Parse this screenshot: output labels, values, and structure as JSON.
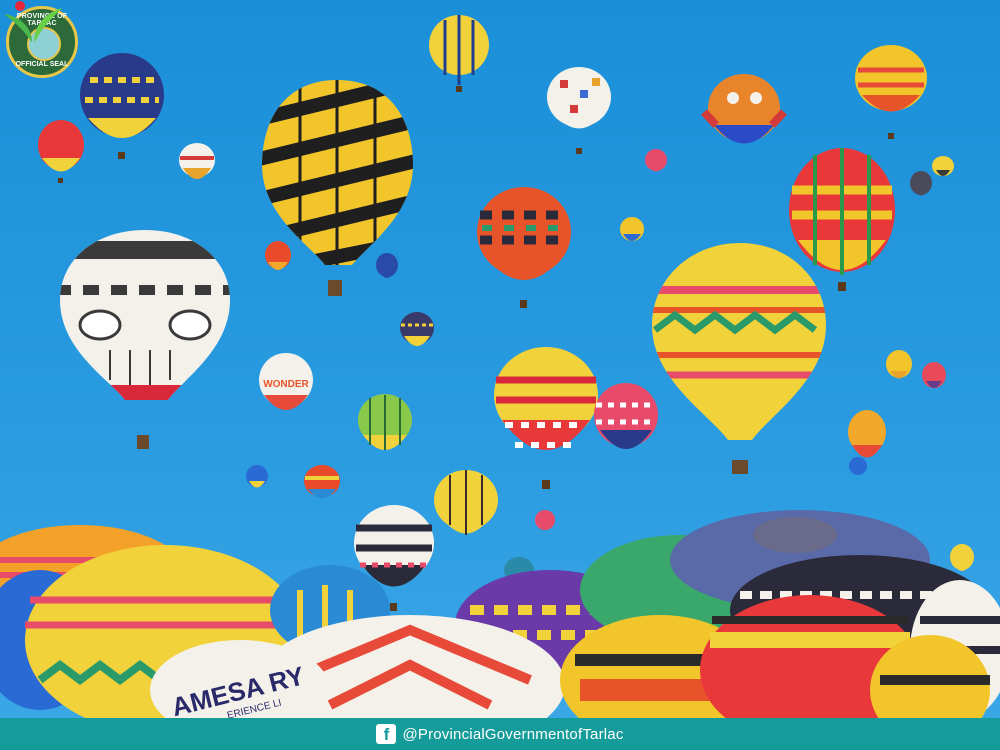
{
  "logo": {
    "seal_top_text": "PROVINCE OF TARLAC",
    "seal_bottom_text": "OFFICIAL SEAL"
  },
  "footer": {
    "icon": "facebook-icon",
    "handle": "@ProvincialGovernmentofTarlac"
  },
  "balloon_labels": {
    "wonder": "WONDER",
    "mesa": "AMESA RY",
    "mesa_sub": "ERIENCE LI"
  },
  "colors": {
    "sky": "#2a9be0",
    "footer_bg": "#159c9a",
    "seal_green": "#2d6a3a",
    "seal_gold": "#e8c64a"
  }
}
